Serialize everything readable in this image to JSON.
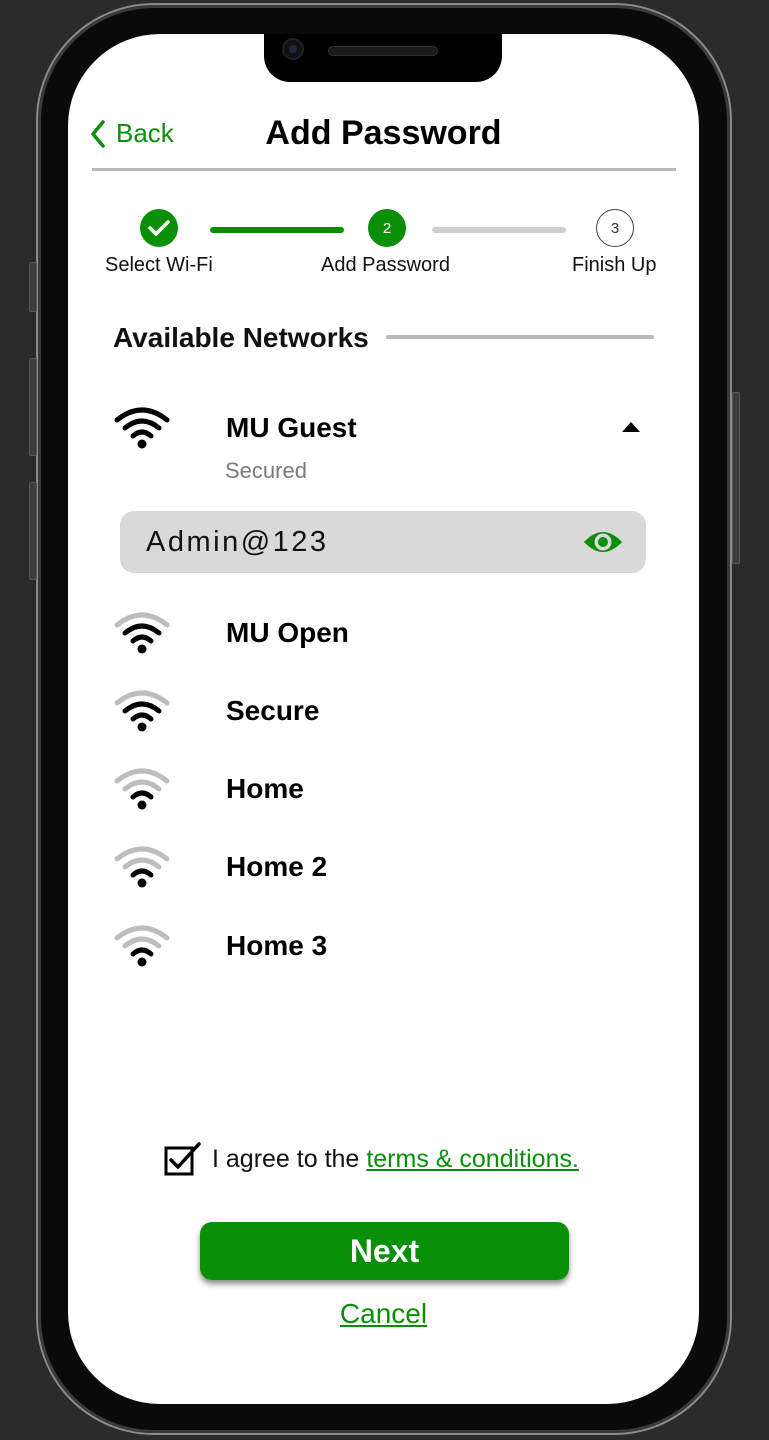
{
  "header": {
    "back_label": "Back",
    "title": "Add Password"
  },
  "stepper": {
    "steps": [
      {
        "label": "Select Wi-Fi",
        "number": "1",
        "state": "done"
      },
      {
        "label": "Add Password",
        "number": "2",
        "state": "active"
      },
      {
        "label": "Finish Up",
        "number": "3",
        "state": "pending"
      }
    ]
  },
  "networks": {
    "section_title": "Available Networks",
    "expanded": {
      "name": "MU Guest",
      "status": "Secured",
      "password_value": "Admin@123",
      "icon": "wifi-icon"
    },
    "list": [
      {
        "name": "MU Open",
        "icon": "wifi-icon"
      },
      {
        "name": "Secure",
        "icon": "wifi-icon"
      },
      {
        "name": "Home",
        "icon": "wifi-icon"
      },
      {
        "name": "Home 2",
        "icon": "wifi-icon"
      },
      {
        "name": "Home 3",
        "icon": "wifi-icon"
      }
    ]
  },
  "footer": {
    "agree_text": "I agree to the",
    "terms_link": "terms & conditions.",
    "agree_checked": true,
    "next_label": "Next",
    "cancel_label": "Cancel"
  },
  "colors": {
    "accent": "#0a8f08",
    "divider": "#b9b9b9",
    "input_bg": "#d9d9d9"
  }
}
